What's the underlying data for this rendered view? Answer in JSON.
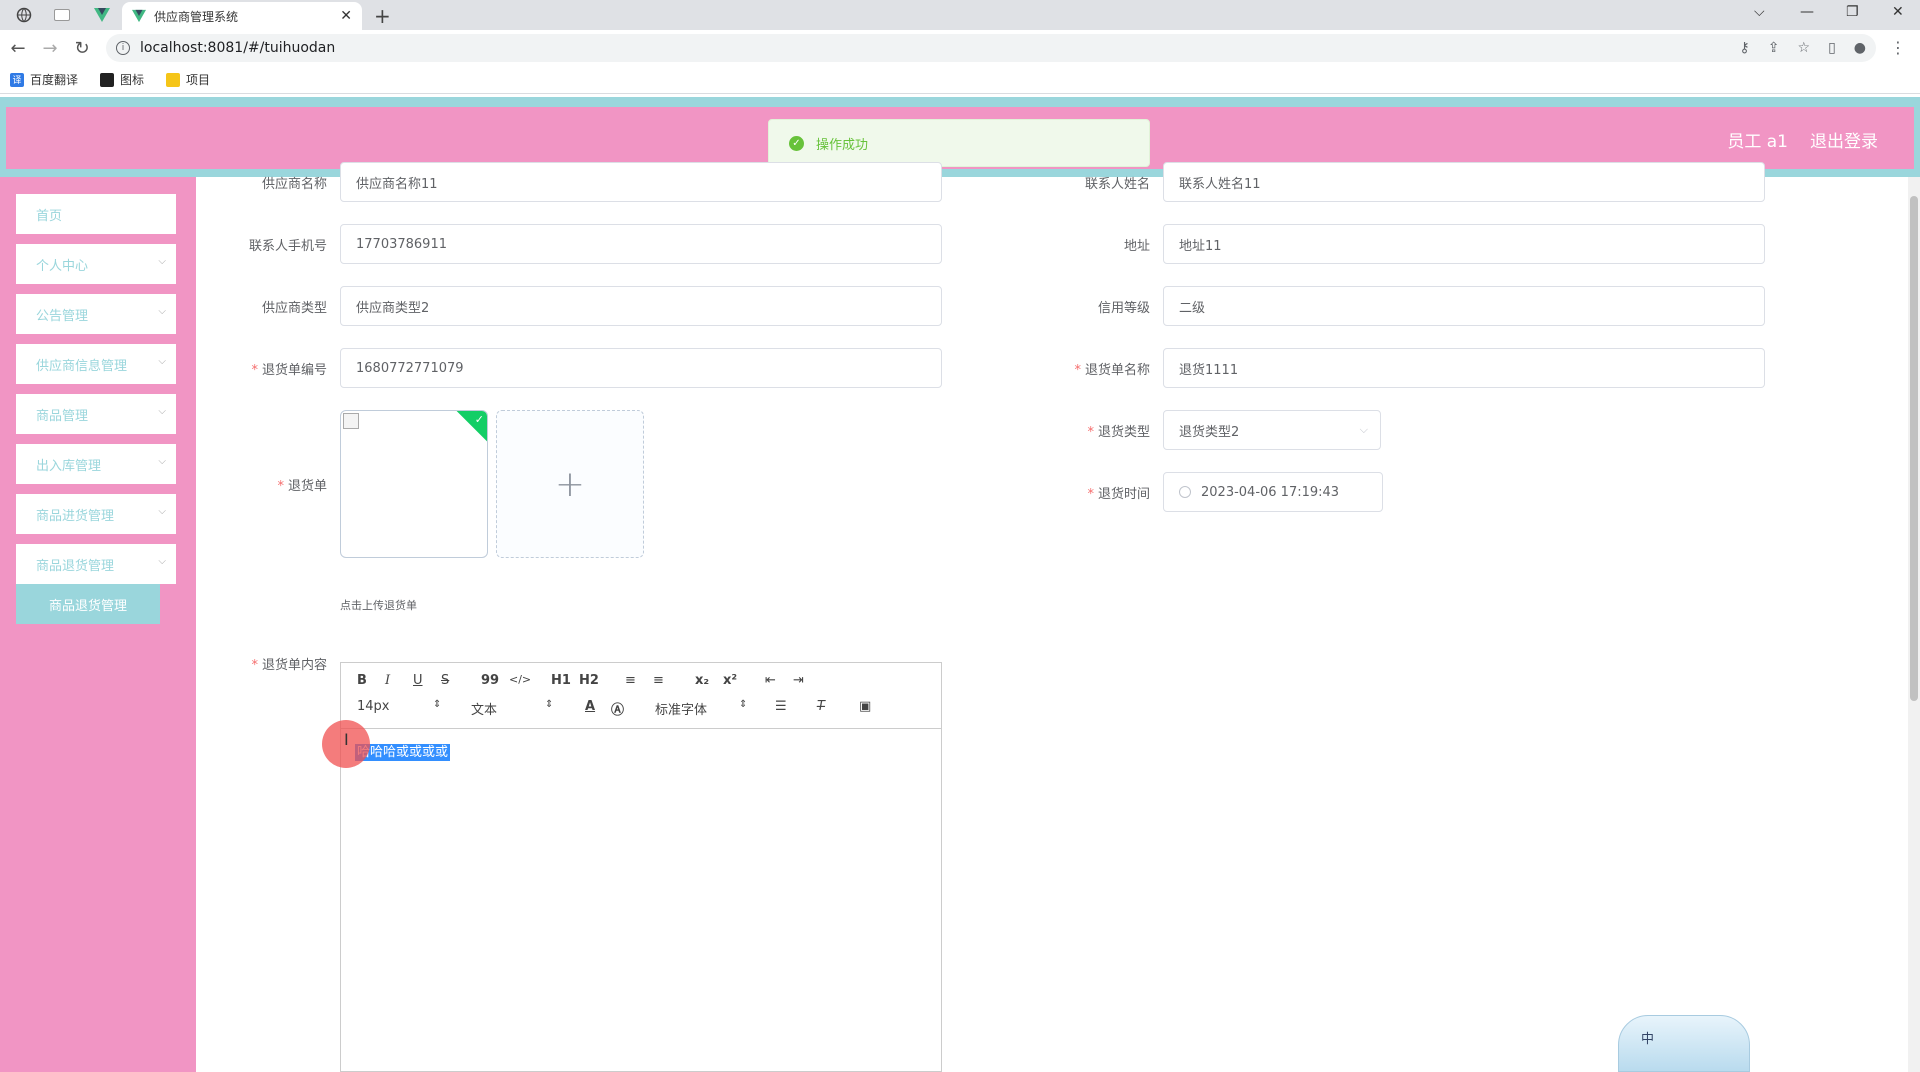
{
  "browser": {
    "tab_title": "供应商管理系统",
    "url": "localhost:8081/#/tuihuodan",
    "bookmarks": [
      "百度翻译",
      "图标",
      "项目"
    ]
  },
  "header": {
    "user": "员工 a1",
    "logout": "退出登录",
    "toast": "操作成功"
  },
  "sidebar": {
    "items": [
      "首页",
      "个人中心",
      "公告管理",
      "供应商信息管理",
      "商品管理",
      "出入库管理",
      "商品进货管理",
      "商品退货管理"
    ],
    "submenu_active": "商品退货管理"
  },
  "form": {
    "supplier_name_label": "供应商名称",
    "supplier_name": "供应商名称11",
    "contact_name_label": "联系人姓名",
    "contact_name": "联系人姓名11",
    "phone_label": "联系人手机号",
    "phone": "17703786911",
    "address_label": "地址",
    "address": "地址11",
    "supplier_type_label": "供应商类型",
    "supplier_type": "供应商类型2",
    "credit_label": "信用等级",
    "credit": "二级",
    "order_no_label": "退货单编号",
    "order_no": "1680772771079",
    "order_name_label": "退货单名称",
    "order_name": "退货1111",
    "image_label": "退货单",
    "return_type_label": "退货类型",
    "return_type": "退货类型2",
    "return_time_label": "退货时间",
    "return_time": "2023-04-06 17:19:43",
    "upload_tip": "点击上传退货单",
    "content_label": "退货单内容",
    "content_text": "哈哈哈或或或或"
  },
  "editor": {
    "font_size": "14px",
    "text_style": "文本",
    "font_family": "标准字体",
    "buttons": [
      "B",
      "I",
      "U",
      "S",
      "99",
      "</>",
      "H1",
      "H2",
      "≡",
      "≡",
      "x₂",
      "x²",
      "⇤",
      "⇥"
    ]
  },
  "ime": {
    "label": "中"
  }
}
